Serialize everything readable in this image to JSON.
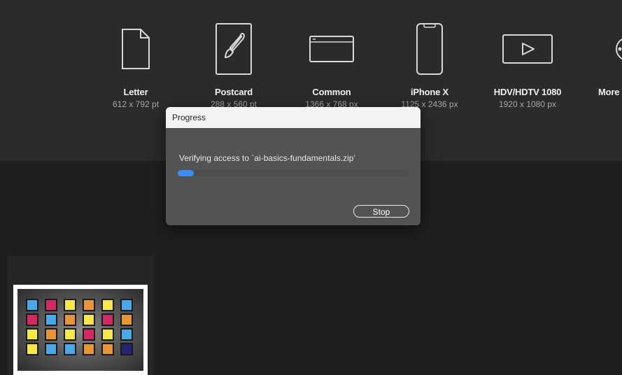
{
  "presets": [
    {
      "name": "Letter",
      "dims": "612 x 792 pt",
      "icon": "document-icon"
    },
    {
      "name": "Postcard",
      "dims": "288 x 560 pt",
      "icon": "brush-icon"
    },
    {
      "name": "Common",
      "dims": "1366 x 768 px",
      "icon": "browser-window-icon"
    },
    {
      "name": "iPhone X",
      "dims": "1125 x 2436 px",
      "icon": "phone-icon"
    },
    {
      "name": "HDV/HDTV 1080",
      "dims": "1920 x 1080 px",
      "icon": "video-play-icon"
    },
    {
      "name": "More",
      "dims": "",
      "icon": "more-icon"
    }
  ],
  "dialog": {
    "title": "Progress",
    "message": "Verifying access to `ai-basics-fundamentals.zip’",
    "progress": 0.07,
    "stop_label": "Stop"
  },
  "recent": {
    "swatch_colors": {
      "blue": "#4aa7e8",
      "pink": "#d42a64",
      "yellow": "#f7e84a",
      "orange": "#e8953a",
      "navy": "#262472"
    },
    "swatch_rows": [
      [
        "blue",
        "pink",
        "yellow",
        "orange",
        "yellow",
        "blue"
      ],
      [
        "pink",
        "blue",
        "orange",
        "yellow",
        "pink",
        "orange"
      ],
      [
        "yellow",
        "orange",
        "yellow",
        "pink",
        "yellow",
        "blue"
      ],
      [
        "yellow",
        "blue",
        "blue",
        "orange",
        "orange",
        "navy"
      ]
    ]
  }
}
